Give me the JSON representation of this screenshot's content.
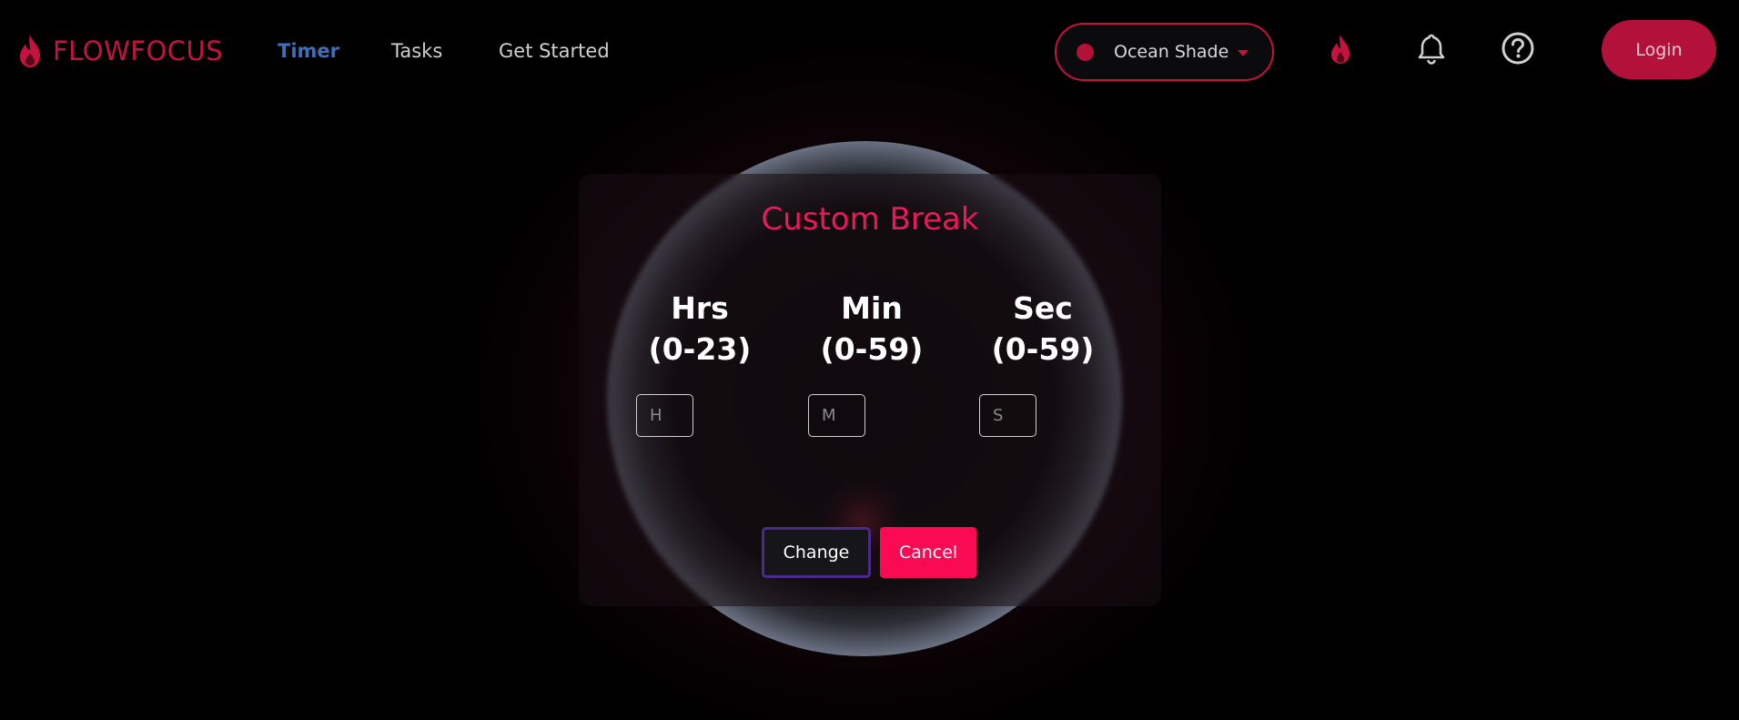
{
  "brand": {
    "name": "FLOWFOCUS",
    "icon": "flame-icon"
  },
  "nav": {
    "links": [
      {
        "label": "Timer",
        "active": true
      },
      {
        "label": "Tasks",
        "active": false
      },
      {
        "label": "Get Started",
        "active": false
      }
    ]
  },
  "theme_select": {
    "value": "Ocean Shade",
    "dot_color": "#b3103a"
  },
  "toolbar": {
    "icons": [
      "flame-icon",
      "bell-icon",
      "help-circle-icon"
    ],
    "login_label": "Login"
  },
  "modal": {
    "title": "Custom Break",
    "fields": [
      {
        "label": "Hrs",
        "range": "(0-23)",
        "placeholder": "H"
      },
      {
        "label": "Min",
        "range": "(0-59)",
        "placeholder": "M"
      },
      {
        "label": "Sec",
        "range": "(0-59)",
        "placeholder": "S"
      }
    ],
    "change_label": "Change",
    "cancel_label": "Cancel"
  },
  "colors": {
    "accent": "#c6123e",
    "title": "#f0165a",
    "cancel": "#fa0a52",
    "active_link": "#3f6fb6",
    "change_border": "#4a2a8c"
  }
}
